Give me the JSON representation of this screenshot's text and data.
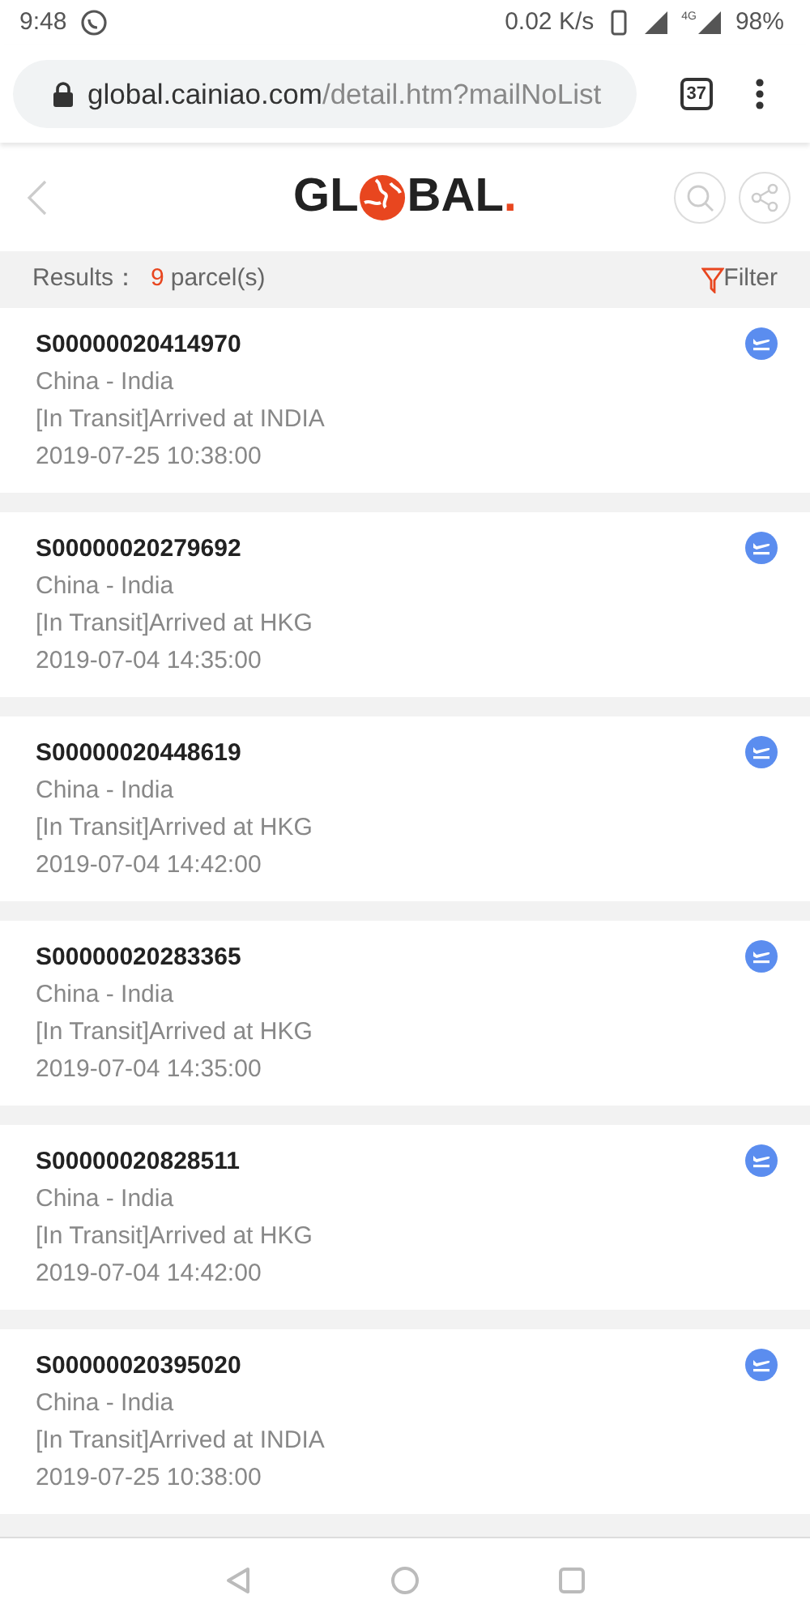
{
  "status_bar": {
    "time": "9:48",
    "speed": "0.02 K/s",
    "network": "4G",
    "battery": "98%"
  },
  "browser": {
    "url_host": "global.cainiao.com",
    "url_path": "/detail.htm?mailNoList",
    "tab_count": "37"
  },
  "header": {
    "logo_start": "GL",
    "logo_end": "BAL",
    "logo_dot": "."
  },
  "results": {
    "label": "Results：",
    "count": "9",
    "unit": "parcel(s)",
    "filter": "Filter"
  },
  "parcels": [
    {
      "number": "S00000020414970",
      "route": "China - India",
      "status": "[In Transit]Arrived at INDIA",
      "time": "2019-07-25 10:38:00"
    },
    {
      "number": "S00000020279692",
      "route": "China - India",
      "status": "[In Transit]Arrived at HKG",
      "time": "2019-07-04 14:35:00"
    },
    {
      "number": "S00000020448619",
      "route": "China - India",
      "status": "[In Transit]Arrived at HKG",
      "time": "2019-07-04 14:42:00"
    },
    {
      "number": "S00000020283365",
      "route": "China - India",
      "status": "[In Transit]Arrived at HKG",
      "time": "2019-07-04 14:35:00"
    },
    {
      "number": "S00000020828511",
      "route": "China - India",
      "status": "[In Transit]Arrived at HKG",
      "time": "2019-07-04 14:42:00"
    },
    {
      "number": "S00000020395020",
      "route": "China - India",
      "status": "[In Transit]Arrived at INDIA",
      "time": "2019-07-25 10:38:00"
    }
  ]
}
